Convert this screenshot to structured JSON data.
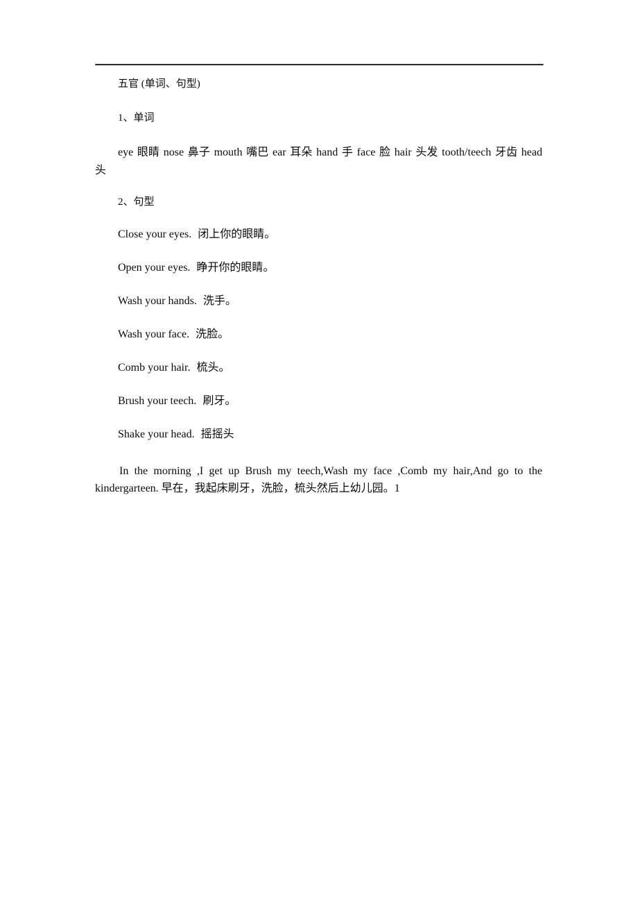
{
  "document": {
    "title": "五官 (单词、句型)",
    "sections": {
      "words_heading": "1、单词",
      "patterns_heading": "2、句型"
    },
    "word_list": "eye 眼睛 nose 鼻子 mouth 嘴巴 ear 耳朵 hand 手 face 脸 hair 头发 tooth/teech 牙齿 head 头",
    "sentence_patterns": [
      {
        "english": "Close your eyes.",
        "chinese": "闭上你的眼睛。"
      },
      {
        "english": "Open your eyes.",
        "chinese": "睁开你的眼睛。"
      },
      {
        "english": "Wash your hands.",
        "chinese": "洗手。"
      },
      {
        "english": "Wash your face.",
        "chinese": "洗脸。"
      },
      {
        "english": "Comb your hair.",
        "chinese": "梳头。"
      },
      {
        "english": "Brush your teech.",
        "chinese": "刷牙。"
      },
      {
        "english": "Shake your head.",
        "chinese": "摇摇头"
      }
    ],
    "closing_paragraph": "In the morning ,I get up Brush my teech,Wash my face ,Comb my hair,And go to the kindergarteen. 早在，我起床刷牙，洗脸，梳头然后上幼儿园。1",
    "colors": {
      "text": "#0b0b0b",
      "rule": "#2b2b2b",
      "background": "#ffffff"
    }
  }
}
